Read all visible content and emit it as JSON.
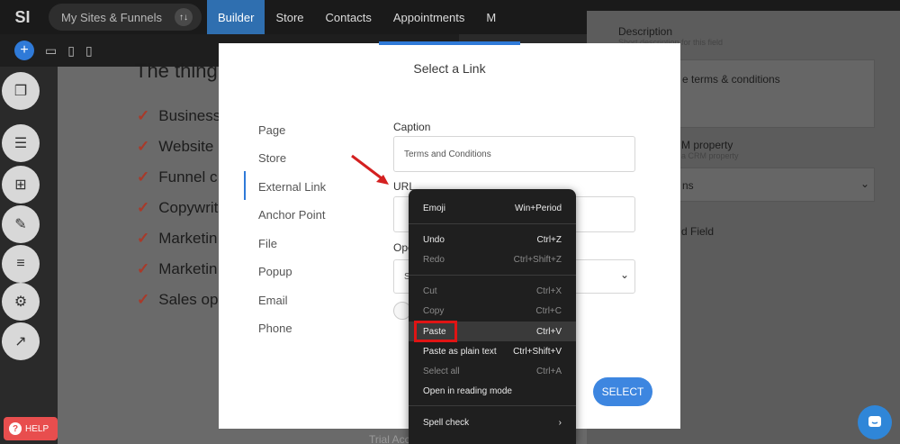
{
  "nav": {
    "logo": "SI",
    "site_selector": "My Sites & Funnels",
    "site_badge": "↑↓",
    "tabs": [
      "Builder",
      "Store",
      "Contacts",
      "Appointments",
      "M"
    ]
  },
  "canvas": {
    "title": "The thing",
    "items": [
      "Business",
      "Website",
      "Funnel c",
      "Copywrit",
      "Marketin",
      "Marketin",
      "Sales op"
    ],
    "footer": "Trial Acc"
  },
  "right_panel": {
    "description_label": "Description",
    "description_sub": "Short description for this field",
    "terms_text": "e terms & conditions",
    "crm_label": "M property",
    "crm_sub": "a CRM property",
    "select_value": "ns",
    "hidden_label": "d Field"
  },
  "modal": {
    "title": "Select a Link",
    "menu": [
      "Page",
      "Store",
      "External Link",
      "Anchor Point",
      "File",
      "Popup",
      "Email",
      "Phone"
    ],
    "caption_label": "Caption",
    "caption_value": "Terms and Conditions",
    "url_label": "URL",
    "open_label": "Ope",
    "open_value": "S",
    "select_button": "SELECT"
  },
  "context_menu": {
    "items": [
      {
        "label": "Emoji",
        "shortcut": "Win+Period",
        "disabled": false
      },
      {
        "label": "Undo",
        "shortcut": "Ctrl+Z",
        "disabled": false
      },
      {
        "label": "Redo",
        "shortcut": "Ctrl+Shift+Z",
        "disabled": true
      },
      {
        "label": "Cut",
        "shortcut": "Ctrl+X",
        "disabled": true
      },
      {
        "label": "Copy",
        "shortcut": "Ctrl+C",
        "disabled": true
      },
      {
        "label": "Paste",
        "shortcut": "Ctrl+V",
        "disabled": false
      },
      {
        "label": "Paste as plain text",
        "shortcut": "Ctrl+Shift+V",
        "disabled": false
      },
      {
        "label": "Select all",
        "shortcut": "Ctrl+A",
        "disabled": true
      },
      {
        "label": "Open in reading mode",
        "shortcut": "",
        "disabled": false
      },
      {
        "label": "Spell check",
        "shortcut": "›",
        "disabled": false
      }
    ]
  },
  "help": {
    "label": "HELP",
    "icon": "?"
  },
  "colors": {
    "accent": "#2f7ad8",
    "highlight_box": "#e01414",
    "arrow": "#d42020"
  }
}
